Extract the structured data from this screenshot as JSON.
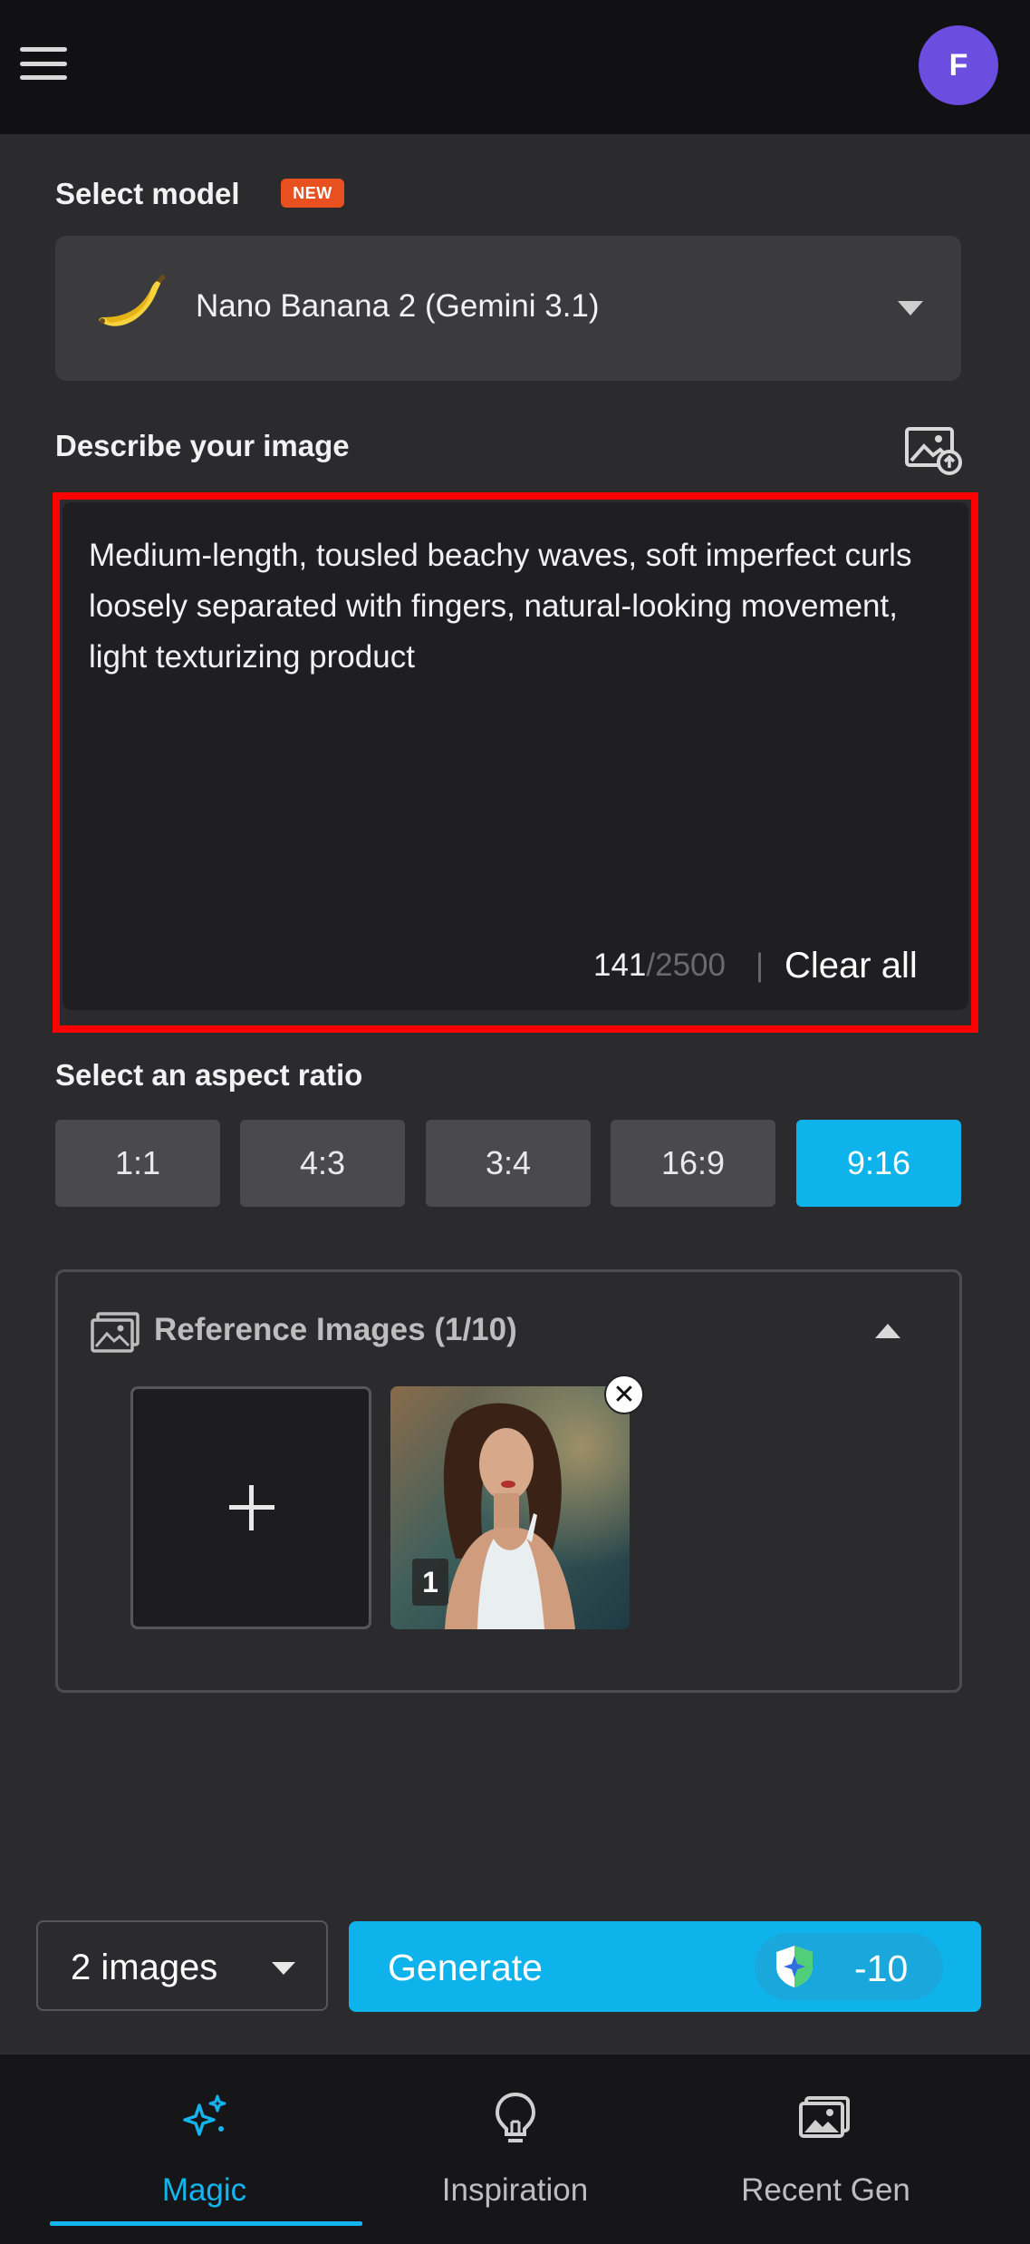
{
  "header": {
    "avatar_initial": "F"
  },
  "model": {
    "section_label": "Select model",
    "badge": "NEW",
    "selected": "Nano Banana 2 (Gemini 3.1)"
  },
  "prompt": {
    "section_label": "Describe your image",
    "text": "Medium-length, tousled beachy waves, soft imperfect curls loosely separated with fingers, natural-looking movement, light texturizing product",
    "char_count": "141",
    "char_max": "/2500",
    "separator": "|",
    "clear_label": "Clear all"
  },
  "aspect_ratio": {
    "section_label": "Select an aspect ratio",
    "options": [
      "1:1",
      "4:3",
      "3:4",
      "16:9",
      "9:16"
    ],
    "selected": "9:16"
  },
  "reference_images": {
    "title": "Reference Images (1/10)",
    "items": [
      {
        "index_label": "1"
      }
    ],
    "close_glyph": "✕"
  },
  "actions": {
    "image_count": "2 images",
    "generate_label": "Generate",
    "credit_cost": "-10"
  },
  "bottom_nav": {
    "items": [
      {
        "label": "Magic",
        "icon": "sparkle-icon",
        "active": true
      },
      {
        "label": "Inspiration",
        "icon": "lightbulb-icon",
        "active": false
      },
      {
        "label": "Recent Gen",
        "icon": "gallery-icon",
        "active": false
      }
    ]
  },
  "colors": {
    "accent": "#0eb3ec",
    "badge": "#e8501f",
    "avatar": "#6b4ee0",
    "highlight_outline": "#ff0000"
  }
}
